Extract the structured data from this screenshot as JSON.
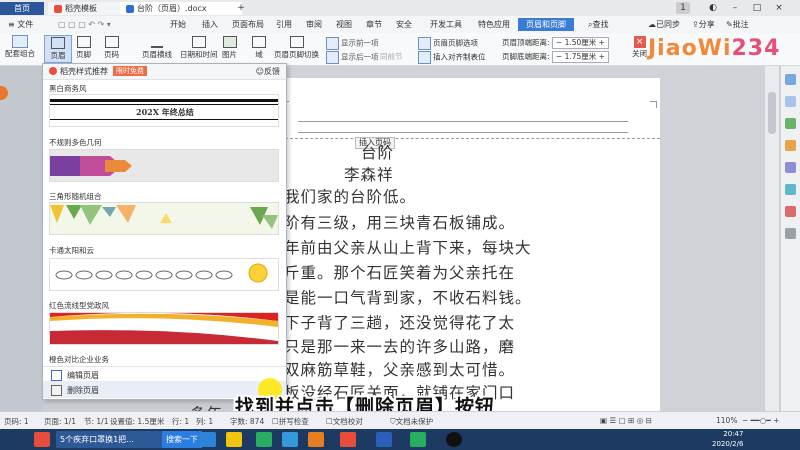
{
  "tabs": {
    "home": "首页",
    "template": "稻壳模板",
    "doc": "台阶（页眉）.docx",
    "add": "+",
    "win_count": "1"
  },
  "menubar": {
    "file": "文件",
    "items": [
      "开始",
      "插入",
      "页面布局",
      "引用",
      "审阅",
      "视图",
      "章节",
      "安全",
      "开发工具",
      "特色应用"
    ],
    "active": "页眉和页脚",
    "search": "查找",
    "sync": "已同步",
    "share": "分享",
    "comment": "批注"
  },
  "toolbar": {
    "items": [
      "配套组合",
      "页眉",
      "页脚",
      "页码",
      "页眉横线",
      "日期和时间",
      "图片",
      "域",
      "页眉页脚切换",
      "显示前一项",
      "显示后一项",
      "同前节",
      "页眉页脚选项",
      "插入对齐制表位"
    ],
    "header_top_label": "页眉顶端距离:",
    "header_top_value": "1.50厘米",
    "footer_bottom_label": "页脚底端距离:",
    "footer_bottom_value": "1.75厘米",
    "close": "关闭"
  },
  "logo": {
    "part1": "JiaoWi",
    "part2": "234"
  },
  "panel": {
    "title": "稻壳样式推荐",
    "badge": "限时免费",
    "feedback": "反馈",
    "sections": [
      {
        "title": "黑白商务风",
        "preview_text": "202X 年终总结"
      },
      {
        "title": "不规则多色几何"
      },
      {
        "title": "三角形随机组合"
      },
      {
        "title": "卡通太阳和云"
      },
      {
        "title": "红色流线型党政风"
      },
      {
        "title": "橙色对比企业业务"
      }
    ],
    "edit_header": "编辑页眉",
    "delete_header": "删除页眉"
  },
  "document": {
    "insert_page_number": "插入页码",
    "lines": [
      "台阶",
      "李森祥",
      "我们家的台阶低。",
      "阶有三级，用三块青石板铺成。",
      "年前由父亲从山上背下来，每块大",
      "斤重。那个石匠笑着为父亲托在",
      "是能一口气背到家，不收石料钱。",
      "下子背了三趟，还没觉得花了太",
      "只是那一来一去的许多山路，磨",
      "双麻筋草鞋，父亲感到太可惜。",
      "板没经石匠关面，就铺在家门口",
      "多年"
    ]
  },
  "status": {
    "page": "页码: 1",
    "pages": "页面: 1/1",
    "section": "节: 1/1",
    "setting": "设置值: 1.5厘米",
    "row": "行: 1",
    "col": "列: 1",
    "words": "字数: 874",
    "spell": "拼写检查",
    "proof": "文档校对",
    "protect": "文档未保护",
    "zoom": "110%"
  },
  "taskbar": {
    "item1": "5个疾弃口罩换1把...",
    "item2": "搜索一下",
    "time": "20:47",
    "date": "2020/2/6"
  },
  "subtitle": "找到并点击【删除页眉】按钮"
}
